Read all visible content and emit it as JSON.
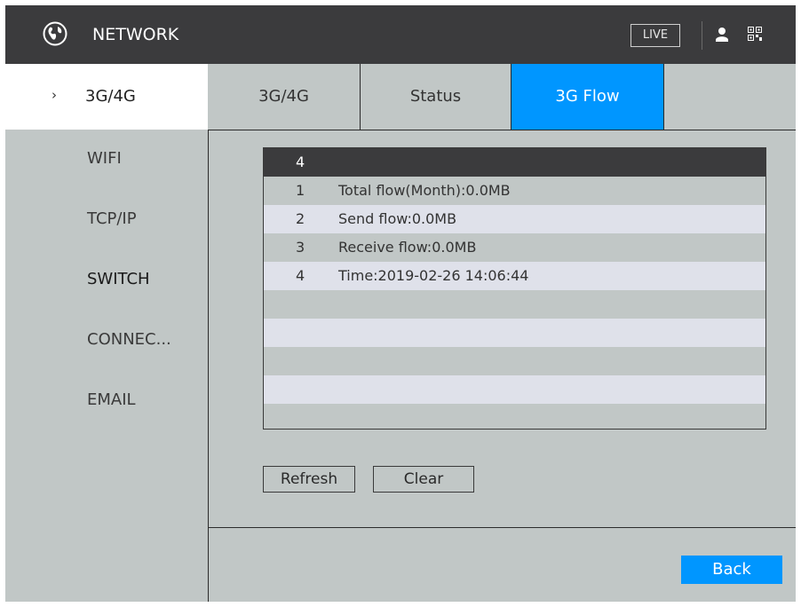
{
  "header": {
    "title": "NETWORK",
    "live_label": "LIVE",
    "icons": [
      "globe-icon",
      "user-icon",
      "qr-code-icon"
    ]
  },
  "sidebar": {
    "active_label": "3G/4G",
    "items": [
      "WIFI",
      "TCP/IP",
      "SWITCH",
      "CONNEC...",
      "EMAIL"
    ]
  },
  "tabs": [
    {
      "label": "3G/4G",
      "active": false
    },
    {
      "label": "Status",
      "active": false
    },
    {
      "label": "3G Flow",
      "active": true
    }
  ],
  "table": {
    "header": "4",
    "rows": [
      {
        "num": "1",
        "text": "Total flow(Month):0.0MB"
      },
      {
        "num": "2",
        "text": "Send flow:0.0MB"
      },
      {
        "num": "3",
        "text": "Receive flow:0.0MB"
      },
      {
        "num": "4",
        "text": "Time:2019-02-26 14:06:44"
      },
      {
        "num": "",
        "text": ""
      },
      {
        "num": "",
        "text": ""
      },
      {
        "num": "",
        "text": ""
      },
      {
        "num": "",
        "text": ""
      },
      {
        "num": "",
        "text": ""
      }
    ]
  },
  "buttons": {
    "refresh": "Refresh",
    "clear": "Clear",
    "back": "Back"
  },
  "colors": {
    "accent": "#0096ff",
    "titlebar": "#3b3b3d",
    "background": "#c1c7c6"
  }
}
